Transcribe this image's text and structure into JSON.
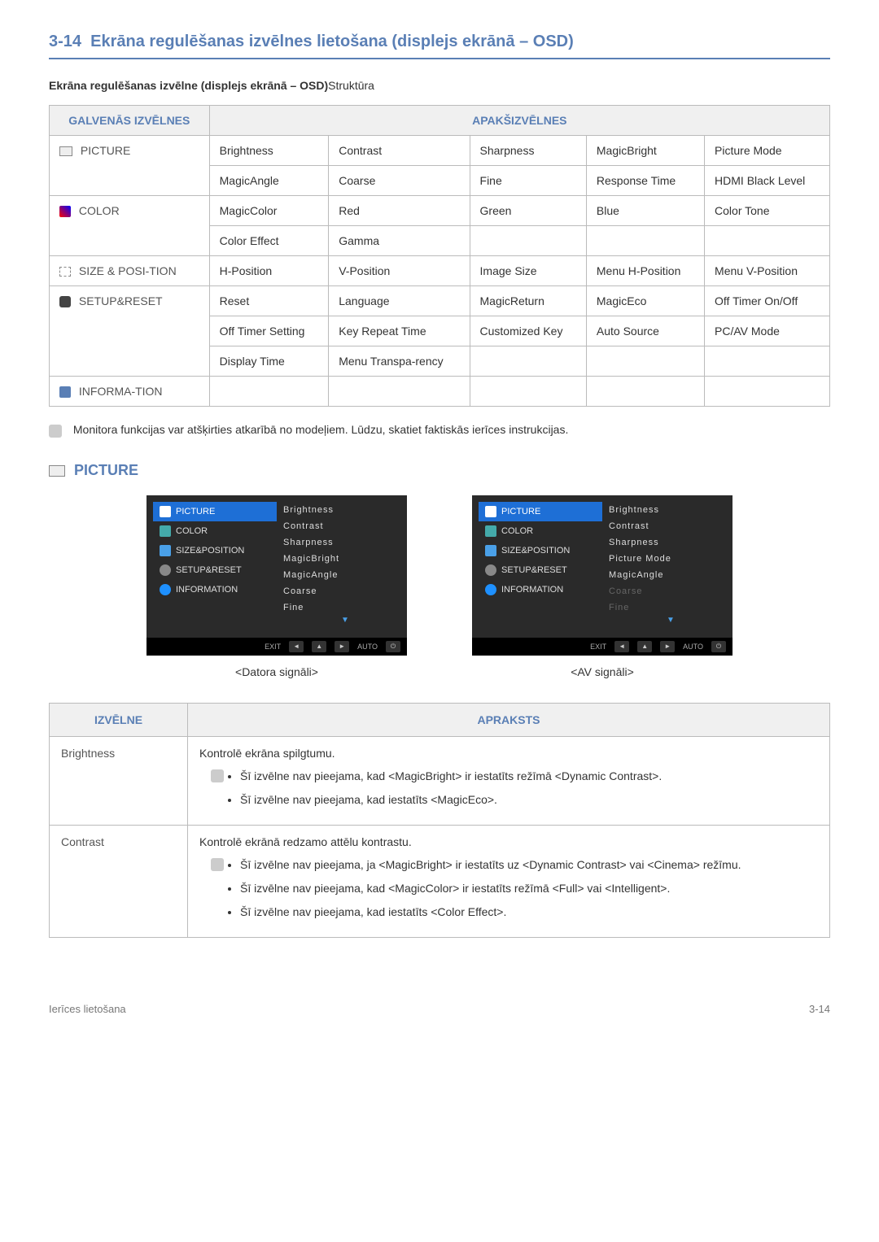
{
  "section": {
    "number": "3-14",
    "title": "Ekrāna regulēšanas izvēlnes lietošana (displejs ekrānā – OSD)"
  },
  "subtitle": {
    "bold": "Ekrāna regulēšanas izvēlne (displejs ekrānā – OSD)",
    "rest": "Struktūra"
  },
  "table1": {
    "header_main": "GALVENĀS IZVĒLNES",
    "header_sub": "APAKŠIZVĒLNES",
    "rows": [
      {
        "menu": "PICTURE",
        "cells": [
          [
            "Brightness",
            "Contrast",
            "Sharpness",
            "MagicBright",
            "Picture Mode"
          ],
          [
            "MagicAngle",
            "Coarse",
            "Fine",
            "Response Time",
            "HDMI Black Level"
          ]
        ]
      },
      {
        "menu": "COLOR",
        "cells": [
          [
            "MagicColor",
            "Red",
            "Green",
            "Blue",
            "Color Tone"
          ],
          [
            "Color Effect",
            "Gamma",
            "",
            "",
            ""
          ]
        ]
      },
      {
        "menu": "SIZE & POSI-TION",
        "cells": [
          [
            "H-Position",
            "V-Position",
            "Image Size",
            "Menu H-Position",
            "Menu V-Position"
          ]
        ]
      },
      {
        "menu": "SETUP&RESET",
        "cells": [
          [
            "Reset",
            "Language",
            "MagicReturn",
            "MagicEco",
            "Off Timer On/Off"
          ],
          [
            "Off Timer Setting",
            "Key Repeat Time",
            "Customized Key",
            "Auto Source",
            "PC/AV Mode"
          ],
          [
            "Display Time",
            "Menu Transpa-rency",
            "",
            "",
            ""
          ]
        ]
      },
      {
        "menu": "INFORMA-TION",
        "cells": [
          [
            "",
            "",
            "",
            "",
            ""
          ]
        ]
      }
    ]
  },
  "note1": "Monitora funkcijas var atšķirties atkarībā no modeļiem. Lūdzu, skatiet faktiskās ierīces instrukcijas.",
  "picture_heading": "PICTURE",
  "osd": {
    "left_menu": [
      "PICTURE",
      "COLOR",
      "SIZE&POSITION",
      "SETUP&RESET",
      "INFORMATION"
    ],
    "right_a": [
      "Brightness",
      "Contrast",
      "Sharpness",
      "MagicBright",
      "MagicAngle",
      "Coarse",
      "Fine"
    ],
    "right_b": [
      {
        "t": "Brightness",
        "d": false
      },
      {
        "t": "Contrast",
        "d": false
      },
      {
        "t": "Sharpness",
        "d": false
      },
      {
        "t": "Picture Mode",
        "d": false
      },
      {
        "t": "MagicAngle",
        "d": false
      },
      {
        "t": "Coarse",
        "d": true
      },
      {
        "t": "Fine",
        "d": true
      }
    ],
    "footer_exit": "EXIT",
    "footer_auto": "AUTO",
    "caption_a": "<Datora signāli>",
    "caption_b": "<AV signāli>"
  },
  "table2": {
    "h1": "IZVĒLNE",
    "h2": "APRAKSTS",
    "rows": [
      {
        "name": "Brightness",
        "intro": "Kontrolē ekrāna spilgtumu.",
        "items": [
          "Šī izvēlne nav pieejama, kad <MagicBright> ir iestatīts režīmā <Dynamic Contrast>.",
          "Šī izvēlne nav pieejama, kad iestatīts <MagicEco>."
        ]
      },
      {
        "name": "Contrast",
        "intro": "Kontrolē ekrānā redzamo attēlu kontrastu.",
        "items": [
          "Šī izvēlne nav pieejama, ja <MagicBright> ir iestatīts uz <Dynamic Contrast> vai <Cinema> režīmu.",
          "Šī izvēlne nav pieejama, kad <MagicColor> ir iestatīts režīmā <Full> vai <Intelligent>.",
          "Šī izvēlne nav pieejama, kad iestatīts <Color Effect>."
        ]
      }
    ]
  },
  "footer": {
    "left": "Ierīces lietošana",
    "right": "3-14"
  }
}
